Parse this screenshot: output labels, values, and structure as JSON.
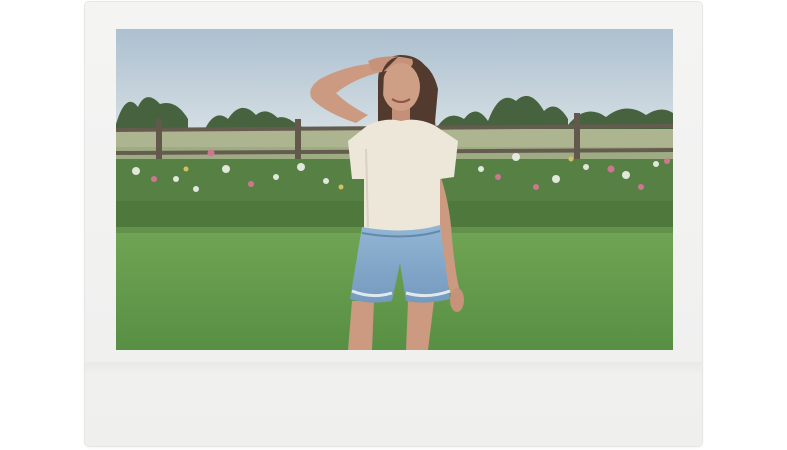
{
  "frame": {
    "type": "instant-photo-frame",
    "border_color": "#f1f1f0"
  },
  "photo": {
    "subject": "woman-shading-eyes",
    "colors": {
      "sky_top": "#a9bfd0",
      "sky_bottom": "#d3dde3",
      "trees": "#3e5a34",
      "pasture": "#a9b38a",
      "fence": "#5d5446",
      "flowers_leaf": "#4f7a3a",
      "lawn": "#5f9a45",
      "shirt": "#ece6d8",
      "shorts": "#7fa6c9",
      "skin": "#c9957a",
      "hair": "#4a3024"
    }
  }
}
